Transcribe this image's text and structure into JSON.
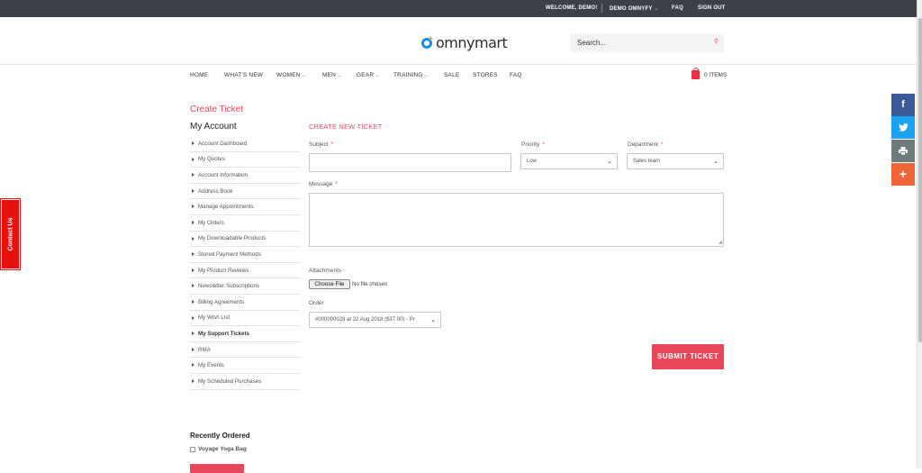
{
  "topbar": {
    "welcome": "WELCOME, DEMO!",
    "account": "DEMO OMNYFY",
    "account_caret": "⌄",
    "faq": "FAQ",
    "signout": "SIGN OUT"
  },
  "header": {
    "logo_text": "omnymart",
    "search_placeholder": "Search...",
    "search_icon": "⚲"
  },
  "nav": {
    "items": [
      "HOME",
      "WHAT'S NEW",
      "WOMEN",
      "MEN",
      "GEAR",
      "TRAINING",
      "SALE",
      "STORES",
      "FAQ"
    ],
    "caret": "⌄",
    "cart_label": "0 ITEMS"
  },
  "page": {
    "title": "Create Ticket"
  },
  "account": {
    "heading": "My Account",
    "links": [
      "Account Dashboard",
      "My Quotes",
      "Account Information",
      "Address Book",
      "Manage Appointments",
      "My Orders",
      "My Downloadable Products",
      "Stored Payment Methods",
      "My Product Reviews",
      "Newsletter Subscriptions",
      "Billing Agreements",
      "My Wish List",
      "My Support Tickets",
      "RMA",
      "My Events",
      "My Scheduled Purchases"
    ],
    "active_link": "My Support Tickets"
  },
  "recent": {
    "heading": "Recently Ordered",
    "item": "Voyage Yoga Bag"
  },
  "form": {
    "title": "CREATE NEW TICKET",
    "required_mark": "*",
    "subject_label": "Subject",
    "subject_value": "",
    "priority_label": "Priority",
    "priority_value": "Low",
    "department_label": "Department",
    "department_value": "Sales team",
    "message_label": "Message",
    "message_value": "",
    "attachments_label": "Attachments",
    "choose_file": "Choose File",
    "no_file": "No file chosen",
    "order_label": "Order",
    "order_value": "#000000028 at 22 Aug 2018 ($37.00) - Pr",
    "submit": "SUBMIT TICKET",
    "select_chevron": "⌄"
  },
  "contact_tab": "Contact Us",
  "social": [
    {
      "name": "facebook",
      "glyph": "f",
      "color": "#3b5998"
    },
    {
      "name": "twitter",
      "glyph": "🐦",
      "color": "#1da1f2"
    },
    {
      "name": "print",
      "glyph": "⎙",
      "color": "#6d7b7b"
    },
    {
      "name": "share-more",
      "glyph": "+",
      "color": "#f0643a"
    }
  ]
}
